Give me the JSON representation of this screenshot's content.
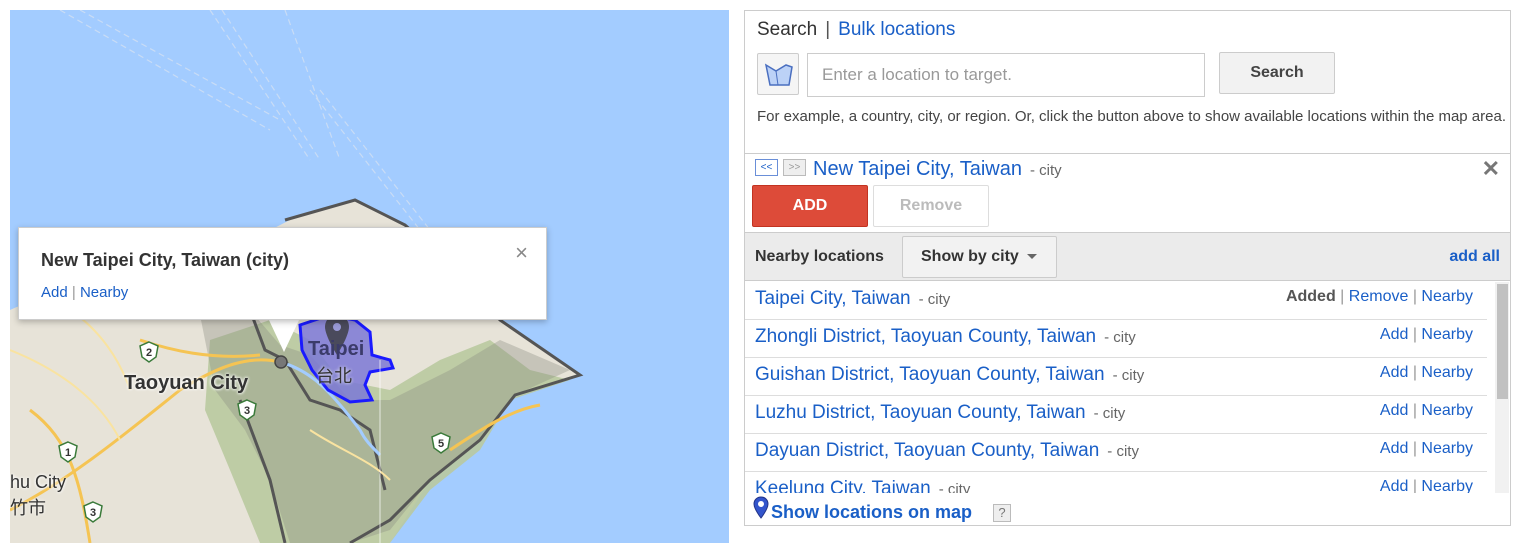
{
  "map": {
    "labels": {
      "taoyuan_city": "Taoyuan City",
      "taipei": "Taipei",
      "taipei_cjk": "台北",
      "hsinchu_partial": "hu City",
      "hsinchu_cjk": "竹市"
    },
    "shields": [
      "2",
      "3",
      "1",
      "3",
      "5"
    ],
    "colors": {
      "water": "#a3ccff",
      "land": "#e9e5dc",
      "highlight": "#7b78d6",
      "outline": "#1a1aff"
    },
    "popup": {
      "title": "New Taipei City, Taiwan (city)",
      "add": "Add",
      "separator": "|",
      "nearby": "Nearby",
      "close": "×"
    }
  },
  "panel": {
    "header": {
      "search": "Search",
      "separator": "|",
      "bulk": "Bulk locations"
    },
    "search": {
      "placeholder": "Enter a location to target.",
      "button": "Search"
    },
    "hint": "For example, a country, city, or region. Or, click the button above to show available locations within the map area.",
    "selected": {
      "prev": "<<",
      "next": ">>",
      "name": "New Taipei City, Taiwan",
      "type": "- city",
      "close": "✕",
      "add": "ADD",
      "remove": "Remove"
    },
    "nearby": {
      "title": "Nearby locations",
      "showby": "Show by city",
      "add_all": "add all",
      "rows": [
        {
          "name": "Taipei City, Taiwan",
          "type": "- city",
          "status": "Added",
          "action": "Remove",
          "nearby": "Nearby"
        },
        {
          "name": "Zhongli District, Taoyuan County, Taiwan",
          "type": "- city",
          "action": "Add",
          "nearby": "Nearby"
        },
        {
          "name": "Guishan District, Taoyuan County, Taiwan",
          "type": "- city",
          "action": "Add",
          "nearby": "Nearby"
        },
        {
          "name": "Luzhu District, Taoyuan County, Taiwan",
          "type": "- city",
          "action": "Add",
          "nearby": "Nearby"
        },
        {
          "name": "Dayuan District, Taoyuan County, Taiwan",
          "type": "- city",
          "action": "Add",
          "nearby": "Nearby"
        },
        {
          "name": "Keelung City, Taiwan",
          "type": "- city",
          "action": "Add",
          "nearby": "Nearby"
        }
      ],
      "sep": "|"
    },
    "footer": {
      "text": "Show locations on map",
      "help": "?"
    }
  }
}
